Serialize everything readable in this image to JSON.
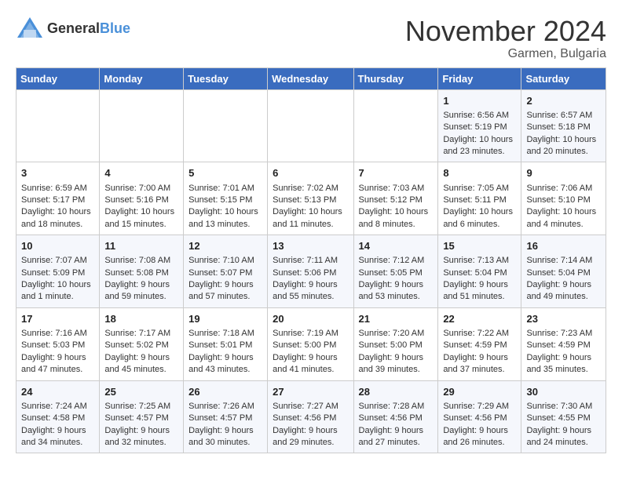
{
  "logo": {
    "general": "General",
    "blue": "Blue"
  },
  "header": {
    "month": "November 2024",
    "location": "Garmen, Bulgaria"
  },
  "weekdays": [
    "Sunday",
    "Monday",
    "Tuesday",
    "Wednesday",
    "Thursday",
    "Friday",
    "Saturday"
  ],
  "weeks": [
    [
      {
        "day": "",
        "info": ""
      },
      {
        "day": "",
        "info": ""
      },
      {
        "day": "",
        "info": ""
      },
      {
        "day": "",
        "info": ""
      },
      {
        "day": "",
        "info": ""
      },
      {
        "day": "1",
        "info": "Sunrise: 6:56 AM\nSunset: 5:19 PM\nDaylight: 10 hours\nand 23 minutes."
      },
      {
        "day": "2",
        "info": "Sunrise: 6:57 AM\nSunset: 5:18 PM\nDaylight: 10 hours\nand 20 minutes."
      }
    ],
    [
      {
        "day": "3",
        "info": "Sunrise: 6:59 AM\nSunset: 5:17 PM\nDaylight: 10 hours\nand 18 minutes."
      },
      {
        "day": "4",
        "info": "Sunrise: 7:00 AM\nSunset: 5:16 PM\nDaylight: 10 hours\nand 15 minutes."
      },
      {
        "day": "5",
        "info": "Sunrise: 7:01 AM\nSunset: 5:15 PM\nDaylight: 10 hours\nand 13 minutes."
      },
      {
        "day": "6",
        "info": "Sunrise: 7:02 AM\nSunset: 5:13 PM\nDaylight: 10 hours\nand 11 minutes."
      },
      {
        "day": "7",
        "info": "Sunrise: 7:03 AM\nSunset: 5:12 PM\nDaylight: 10 hours\nand 8 minutes."
      },
      {
        "day": "8",
        "info": "Sunrise: 7:05 AM\nSunset: 5:11 PM\nDaylight: 10 hours\nand 6 minutes."
      },
      {
        "day": "9",
        "info": "Sunrise: 7:06 AM\nSunset: 5:10 PM\nDaylight: 10 hours\nand 4 minutes."
      }
    ],
    [
      {
        "day": "10",
        "info": "Sunrise: 7:07 AM\nSunset: 5:09 PM\nDaylight: 10 hours\nand 1 minute."
      },
      {
        "day": "11",
        "info": "Sunrise: 7:08 AM\nSunset: 5:08 PM\nDaylight: 9 hours\nand 59 minutes."
      },
      {
        "day": "12",
        "info": "Sunrise: 7:10 AM\nSunset: 5:07 PM\nDaylight: 9 hours\nand 57 minutes."
      },
      {
        "day": "13",
        "info": "Sunrise: 7:11 AM\nSunset: 5:06 PM\nDaylight: 9 hours\nand 55 minutes."
      },
      {
        "day": "14",
        "info": "Sunrise: 7:12 AM\nSunset: 5:05 PM\nDaylight: 9 hours\nand 53 minutes."
      },
      {
        "day": "15",
        "info": "Sunrise: 7:13 AM\nSunset: 5:04 PM\nDaylight: 9 hours\nand 51 minutes."
      },
      {
        "day": "16",
        "info": "Sunrise: 7:14 AM\nSunset: 5:04 PM\nDaylight: 9 hours\nand 49 minutes."
      }
    ],
    [
      {
        "day": "17",
        "info": "Sunrise: 7:16 AM\nSunset: 5:03 PM\nDaylight: 9 hours\nand 47 minutes."
      },
      {
        "day": "18",
        "info": "Sunrise: 7:17 AM\nSunset: 5:02 PM\nDaylight: 9 hours\nand 45 minutes."
      },
      {
        "day": "19",
        "info": "Sunrise: 7:18 AM\nSunset: 5:01 PM\nDaylight: 9 hours\nand 43 minutes."
      },
      {
        "day": "20",
        "info": "Sunrise: 7:19 AM\nSunset: 5:00 PM\nDaylight: 9 hours\nand 41 minutes."
      },
      {
        "day": "21",
        "info": "Sunrise: 7:20 AM\nSunset: 5:00 PM\nDaylight: 9 hours\nand 39 minutes."
      },
      {
        "day": "22",
        "info": "Sunrise: 7:22 AM\nSunset: 4:59 PM\nDaylight: 9 hours\nand 37 minutes."
      },
      {
        "day": "23",
        "info": "Sunrise: 7:23 AM\nSunset: 4:59 PM\nDaylight: 9 hours\nand 35 minutes."
      }
    ],
    [
      {
        "day": "24",
        "info": "Sunrise: 7:24 AM\nSunset: 4:58 PM\nDaylight: 9 hours\nand 34 minutes."
      },
      {
        "day": "25",
        "info": "Sunrise: 7:25 AM\nSunset: 4:57 PM\nDaylight: 9 hours\nand 32 minutes."
      },
      {
        "day": "26",
        "info": "Sunrise: 7:26 AM\nSunset: 4:57 PM\nDaylight: 9 hours\nand 30 minutes."
      },
      {
        "day": "27",
        "info": "Sunrise: 7:27 AM\nSunset: 4:56 PM\nDaylight: 9 hours\nand 29 minutes."
      },
      {
        "day": "28",
        "info": "Sunrise: 7:28 AM\nSunset: 4:56 PM\nDaylight: 9 hours\nand 27 minutes."
      },
      {
        "day": "29",
        "info": "Sunrise: 7:29 AM\nSunset: 4:56 PM\nDaylight: 9 hours\nand 26 minutes."
      },
      {
        "day": "30",
        "info": "Sunrise: 7:30 AM\nSunset: 4:55 PM\nDaylight: 9 hours\nand 24 minutes."
      }
    ]
  ]
}
